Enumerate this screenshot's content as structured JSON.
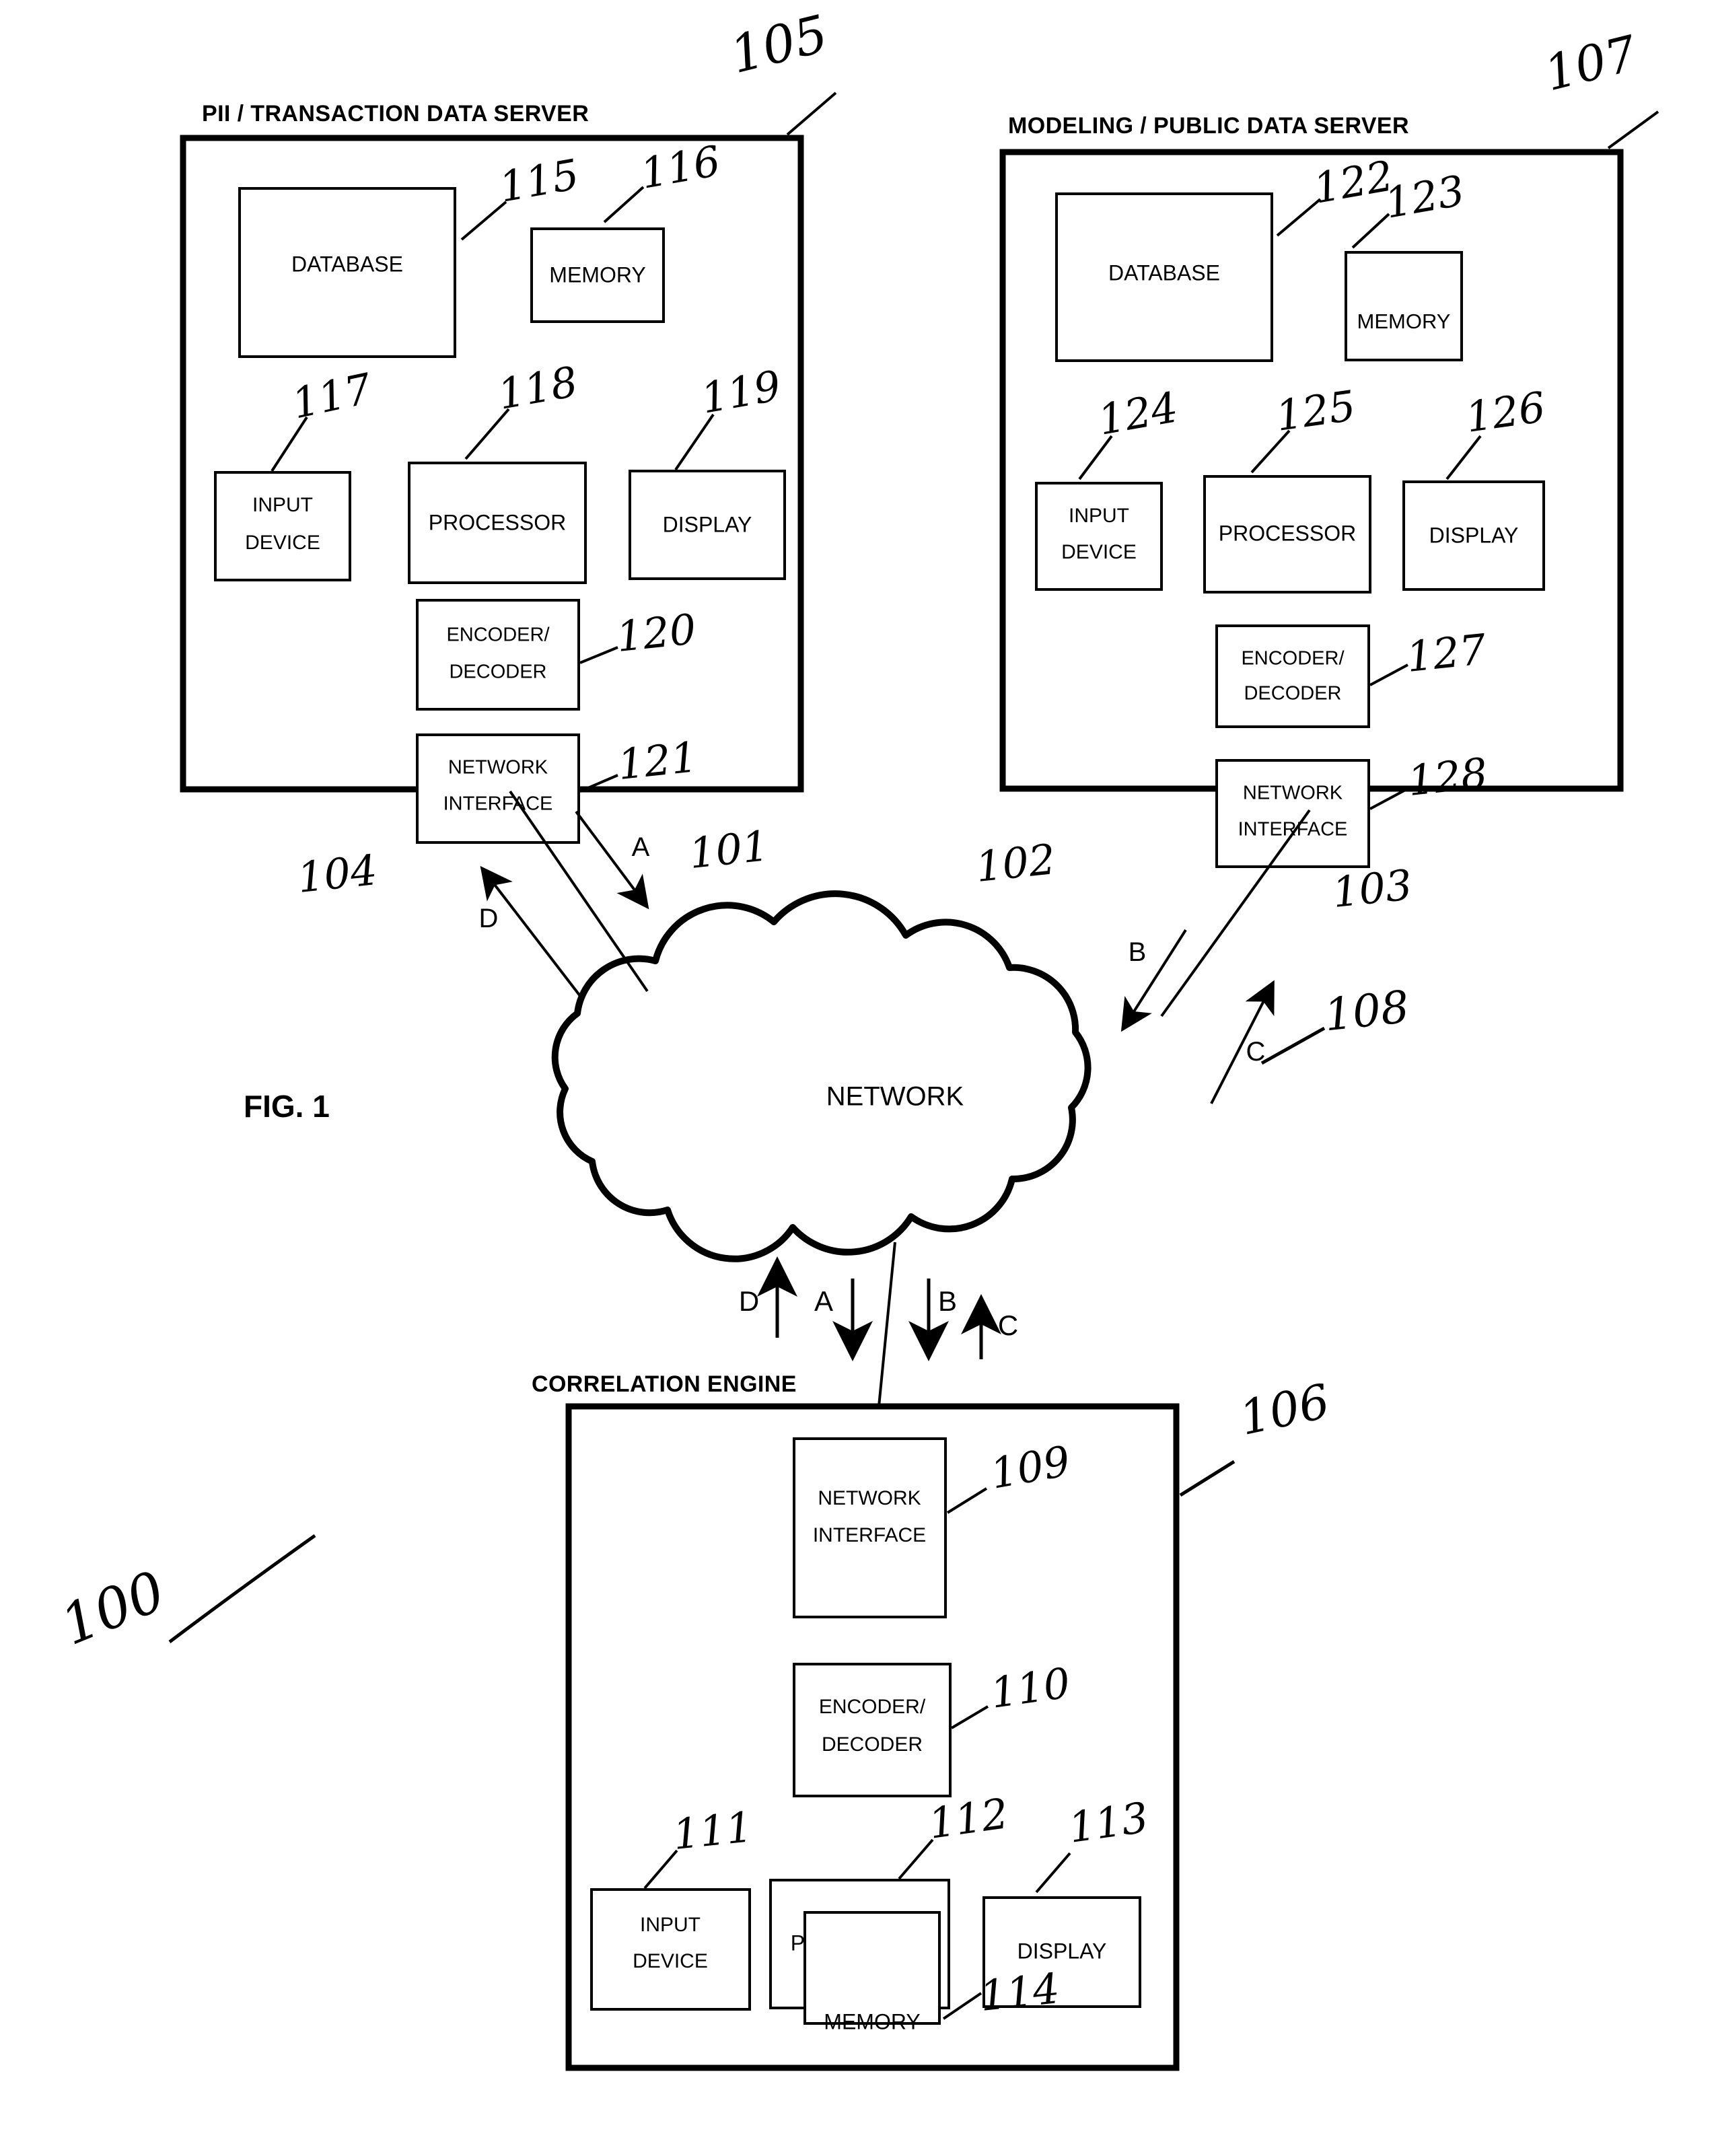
{
  "figure": {
    "caption": "FIG. 1",
    "system_ref": "100"
  },
  "servers": [
    {
      "id": "pii-transaction-data-server",
      "title": "PII / TRANSACTION DATA SERVER",
      "ref": "105",
      "components": [
        {
          "id": "database",
          "label": "DATABASE",
          "ref": "115"
        },
        {
          "id": "memory",
          "label": "MEMORY",
          "ref": "116"
        },
        {
          "id": "input-device",
          "label": "INPUT DEVICE",
          "line1": "INPUT",
          "line2": "DEVICE",
          "ref": "117"
        },
        {
          "id": "processor",
          "label": "PROCESSOR",
          "ref": "118"
        },
        {
          "id": "display",
          "label": "DISPLAY",
          "ref": "119"
        },
        {
          "id": "encoder-decoder",
          "label": "ENCODER/ DECODER",
          "line1": "ENCODER/",
          "line2": "DECODER",
          "ref": "120"
        },
        {
          "id": "network-interface",
          "label": "NETWORK INTERFACE",
          "line1": "NETWORK",
          "line2": "INTERFACE",
          "ref": "121"
        }
      ]
    },
    {
      "id": "modeling-public-data-server",
      "title": "MODELING / PUBLIC DATA SERVER",
      "ref": "107",
      "components": [
        {
          "id": "database",
          "label": "DATABASE",
          "ref": "122"
        },
        {
          "id": "memory",
          "label": "MEMORY",
          "ref": "123"
        },
        {
          "id": "input-device",
          "label": "INPUT DEVICE",
          "line1": "INPUT",
          "line2": "DEVICE",
          "ref": "124"
        },
        {
          "id": "processor",
          "label": "PROCESSOR",
          "ref": "125"
        },
        {
          "id": "display",
          "label": "DISPLAY",
          "ref": "126"
        },
        {
          "id": "encoder-decoder",
          "label": "ENCODER/ DECODER",
          "line1": "ENCODER/",
          "line2": "DECODER",
          "ref": "127"
        },
        {
          "id": "network-interface",
          "label": "NETWORK INTERFACE",
          "line1": "NETWORK",
          "line2": "INTERFACE",
          "ref": "128"
        }
      ]
    },
    {
      "id": "correlation-engine",
      "title": "CORRELATION ENGINE",
      "ref": "106",
      "components": [
        {
          "id": "network-interface",
          "label": "NETWORK INTERFACE",
          "line1": "NETWORK",
          "line2": "INTERFACE",
          "ref": "109"
        },
        {
          "id": "encoder-decoder",
          "label": "ENCODER/ DECODER",
          "line1": "ENCODER/",
          "line2": "DECODER",
          "ref": "110"
        },
        {
          "id": "input-device",
          "label": "INPUT DEVICE",
          "line1": "INPUT",
          "line2": "DEVICE",
          "ref": "111"
        },
        {
          "id": "processor",
          "label": "PROCESSOR",
          "ref": "112"
        },
        {
          "id": "display",
          "label": "DISPLAY",
          "ref": "113"
        },
        {
          "id": "memory",
          "label": "MEMORY",
          "ref": "114"
        }
      ]
    }
  ],
  "network": {
    "label": "NETWORK",
    "ref": "108"
  },
  "flows": [
    {
      "id": "flow-a-upper",
      "letter": "A",
      "ref": "101",
      "direction": "down"
    },
    {
      "id": "flow-b-upper",
      "letter": "B",
      "ref": "102",
      "direction": "down"
    },
    {
      "id": "flow-c-upper",
      "letter": "C",
      "ref": "103",
      "direction": "up"
    },
    {
      "id": "flow-d-upper",
      "letter": "D",
      "ref": "104",
      "direction": "up"
    },
    {
      "id": "flow-d-lower",
      "letter": "D",
      "ref": "",
      "direction": "up"
    },
    {
      "id": "flow-a-lower",
      "letter": "A",
      "ref": "",
      "direction": "down"
    },
    {
      "id": "flow-b-lower",
      "letter": "B",
      "ref": "",
      "direction": "down"
    },
    {
      "id": "flow-c-lower",
      "letter": "C",
      "ref": "",
      "direction": "up"
    }
  ]
}
